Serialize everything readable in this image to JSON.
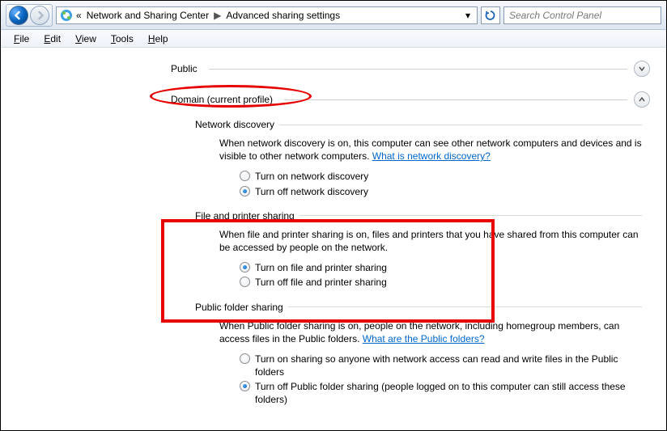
{
  "breadcrumb": {
    "sep1": "«",
    "loc1": "Network and Sharing Center",
    "arrow": "▶",
    "loc2": "Advanced sharing settings"
  },
  "search": {
    "placeholder": "Search Control Panel"
  },
  "menu": {
    "file": "File",
    "edit": "Edit",
    "view": "View",
    "tools": "Tools",
    "help": "Help"
  },
  "sections": {
    "public": {
      "label": "Public"
    },
    "domain": {
      "label": "Domain (current profile)"
    }
  },
  "network_discovery": {
    "title": "Network discovery",
    "desc_a": "When network discovery is on, this computer can see other network computers and devices and is visible to other network computers. ",
    "link": "What is network discovery?",
    "on": "Turn on network discovery",
    "off": "Turn off network discovery"
  },
  "file_printer": {
    "title": "File and printer sharing",
    "desc": "When file and printer sharing is on, files and printers that you have shared from this computer can be accessed by people on the network.",
    "on": "Turn on file and printer sharing",
    "off": "Turn off file and printer sharing"
  },
  "public_folder": {
    "title": "Public folder sharing",
    "desc_a": "When Public folder sharing is on, people on the network, including homegroup members, can access files in the Public folders. ",
    "link": "What are the Public folders?",
    "on": "Turn on sharing so anyone with network access can read and write files in the Public folders",
    "off": "Turn off Public folder sharing (people logged on to this computer can still access these folders)"
  }
}
